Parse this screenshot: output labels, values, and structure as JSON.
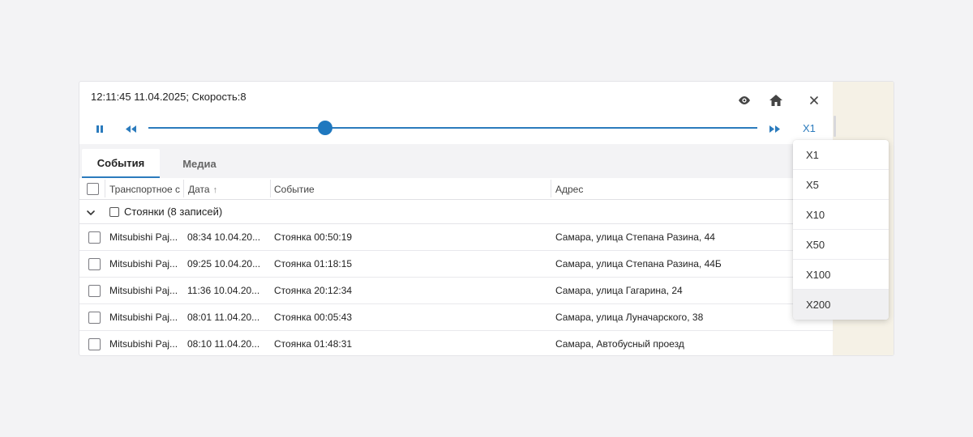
{
  "status": "12:11:45 11.04.2025; Скорость:8",
  "player": {
    "speed_label": "X1",
    "progress": 0.29
  },
  "icons": {
    "eye": "eye-icon",
    "home": "home-icon",
    "close": "close-icon",
    "pause": "pause-icon",
    "rewind": "rewind-icon",
    "forward": "fast-forward-icon"
  },
  "tabs": [
    {
      "label": "События",
      "active": true
    },
    {
      "label": "Медиа",
      "active": false
    }
  ],
  "columns": {
    "vehicle": "Транспортное с",
    "date": "Дата",
    "event": "Событие",
    "address": "Адрес"
  },
  "group": {
    "label": "Стоянки (8 записей)"
  },
  "rows": [
    {
      "vehicle": "Mitsubishi Paj...",
      "date": "08:34 10.04.20...",
      "event": "Стоянка 00:50:19",
      "address": "Самара, улица Степана Разина, 44"
    },
    {
      "vehicle": "Mitsubishi Paj...",
      "date": "09:25 10.04.20...",
      "event": "Стоянка 01:18:15",
      "address": "Самара, улица Степана Разина, 44Б"
    },
    {
      "vehicle": "Mitsubishi Paj...",
      "date": "11:36 10.04.20...",
      "event": "Стоянка 20:12:34",
      "address": "Самара, улица Гагарина, 24"
    },
    {
      "vehicle": "Mitsubishi Paj...",
      "date": "08:01 11.04.20...",
      "event": "Стоянка 00:05:43",
      "address": "Самара, улица Луначарского, 38"
    },
    {
      "vehicle": "Mitsubishi Paj...",
      "date": "08:10 11.04.20...",
      "event": "Стоянка 01:48:31",
      "address": "Самара, Автобусный проезд"
    }
  ],
  "speed_options": [
    "X1",
    "X5",
    "X10",
    "X50",
    "X100",
    "X200"
  ],
  "speed_highlighted": "X200",
  "colors": {
    "accent": "#2b7bbd",
    "beige": "#f5f1e6",
    "background": "#f3f3f5"
  }
}
